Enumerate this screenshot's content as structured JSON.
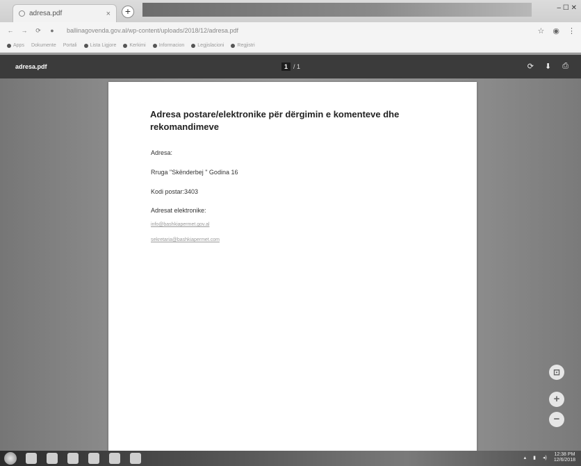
{
  "browser": {
    "tab_title": "adresa.pdf",
    "tab_close": "×",
    "new_tab": "+",
    "window_controls": "– ☐ ✕",
    "url": "ballinagovenda.gov.al/wp-content/uploads/2018/12/adresa.pdf",
    "bookmarks": [
      "Apps",
      "Dokumente",
      "Portali",
      "Lista Ligjore",
      "Kerkimi",
      "Informacion",
      "Legjislacioni",
      "Regjistri"
    ]
  },
  "pdf_viewer": {
    "file_name": "adresa.pdf",
    "page_current": "1",
    "page_total": "/ 1",
    "zoom_fit": "⊡",
    "zoom_in": "+",
    "zoom_out": "−"
  },
  "document": {
    "title": "Adresa postare/elektronike për dërgimin e komenteve dhe rekomandimeve",
    "address_label": "Adresa:",
    "street": "Rruga \"Skënderbej \" Godina 16",
    "postal_code": "Kodi postar:3403",
    "emails_label": "Adresat elektronike:",
    "email_1": "info@bashkiapermet.gov.al",
    "email_2": "sekretaria@bashkiapermet.com"
  },
  "taskbar": {
    "time": "12:38 PM",
    "date": "12/6/2018"
  },
  "colors": {
    "pdf_toolbar": "#3b3b3b",
    "viewer_background": "#8c8c8c",
    "page": "#ffffff"
  }
}
